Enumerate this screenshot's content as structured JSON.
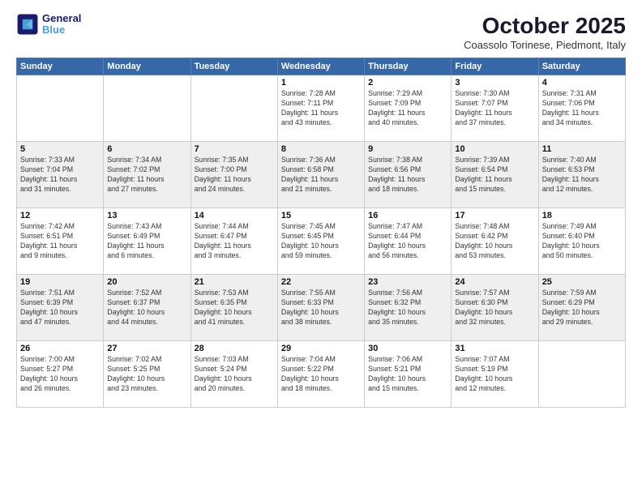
{
  "header": {
    "logo_line1": "General",
    "logo_line2": "Blue",
    "month": "October 2025",
    "location": "Coassolo Torinese, Piedmont, Italy"
  },
  "weekdays": [
    "Sunday",
    "Monday",
    "Tuesday",
    "Wednesday",
    "Thursday",
    "Friday",
    "Saturday"
  ],
  "weeks": [
    [
      {
        "date": "",
        "info": ""
      },
      {
        "date": "",
        "info": ""
      },
      {
        "date": "",
        "info": ""
      },
      {
        "date": "1",
        "info": "Sunrise: 7:28 AM\nSunset: 7:11 PM\nDaylight: 11 hours\nand 43 minutes."
      },
      {
        "date": "2",
        "info": "Sunrise: 7:29 AM\nSunset: 7:09 PM\nDaylight: 11 hours\nand 40 minutes."
      },
      {
        "date": "3",
        "info": "Sunrise: 7:30 AM\nSunset: 7:07 PM\nDaylight: 11 hours\nand 37 minutes."
      },
      {
        "date": "4",
        "info": "Sunrise: 7:31 AM\nSunset: 7:06 PM\nDaylight: 11 hours\nand 34 minutes."
      }
    ],
    [
      {
        "date": "5",
        "info": "Sunrise: 7:33 AM\nSunset: 7:04 PM\nDaylight: 11 hours\nand 31 minutes."
      },
      {
        "date": "6",
        "info": "Sunrise: 7:34 AM\nSunset: 7:02 PM\nDaylight: 11 hours\nand 27 minutes."
      },
      {
        "date": "7",
        "info": "Sunrise: 7:35 AM\nSunset: 7:00 PM\nDaylight: 11 hours\nand 24 minutes."
      },
      {
        "date": "8",
        "info": "Sunrise: 7:36 AM\nSunset: 6:58 PM\nDaylight: 11 hours\nand 21 minutes."
      },
      {
        "date": "9",
        "info": "Sunrise: 7:38 AM\nSunset: 6:56 PM\nDaylight: 11 hours\nand 18 minutes."
      },
      {
        "date": "10",
        "info": "Sunrise: 7:39 AM\nSunset: 6:54 PM\nDaylight: 11 hours\nand 15 minutes."
      },
      {
        "date": "11",
        "info": "Sunrise: 7:40 AM\nSunset: 6:53 PM\nDaylight: 11 hours\nand 12 minutes."
      }
    ],
    [
      {
        "date": "12",
        "info": "Sunrise: 7:42 AM\nSunset: 6:51 PM\nDaylight: 11 hours\nand 9 minutes."
      },
      {
        "date": "13",
        "info": "Sunrise: 7:43 AM\nSunset: 6:49 PM\nDaylight: 11 hours\nand 6 minutes."
      },
      {
        "date": "14",
        "info": "Sunrise: 7:44 AM\nSunset: 6:47 PM\nDaylight: 11 hours\nand 3 minutes."
      },
      {
        "date": "15",
        "info": "Sunrise: 7:45 AM\nSunset: 6:45 PM\nDaylight: 10 hours\nand 59 minutes."
      },
      {
        "date": "16",
        "info": "Sunrise: 7:47 AM\nSunset: 6:44 PM\nDaylight: 10 hours\nand 56 minutes."
      },
      {
        "date": "17",
        "info": "Sunrise: 7:48 AM\nSunset: 6:42 PM\nDaylight: 10 hours\nand 53 minutes."
      },
      {
        "date": "18",
        "info": "Sunrise: 7:49 AM\nSunset: 6:40 PM\nDaylight: 10 hours\nand 50 minutes."
      }
    ],
    [
      {
        "date": "19",
        "info": "Sunrise: 7:51 AM\nSunset: 6:39 PM\nDaylight: 10 hours\nand 47 minutes."
      },
      {
        "date": "20",
        "info": "Sunrise: 7:52 AM\nSunset: 6:37 PM\nDaylight: 10 hours\nand 44 minutes."
      },
      {
        "date": "21",
        "info": "Sunrise: 7:53 AM\nSunset: 6:35 PM\nDaylight: 10 hours\nand 41 minutes."
      },
      {
        "date": "22",
        "info": "Sunrise: 7:55 AM\nSunset: 6:33 PM\nDaylight: 10 hours\nand 38 minutes."
      },
      {
        "date": "23",
        "info": "Sunrise: 7:56 AM\nSunset: 6:32 PM\nDaylight: 10 hours\nand 35 minutes."
      },
      {
        "date": "24",
        "info": "Sunrise: 7:57 AM\nSunset: 6:30 PM\nDaylight: 10 hours\nand 32 minutes."
      },
      {
        "date": "25",
        "info": "Sunrise: 7:59 AM\nSunset: 6:29 PM\nDaylight: 10 hours\nand 29 minutes."
      }
    ],
    [
      {
        "date": "26",
        "info": "Sunrise: 7:00 AM\nSunset: 5:27 PM\nDaylight: 10 hours\nand 26 minutes."
      },
      {
        "date": "27",
        "info": "Sunrise: 7:02 AM\nSunset: 5:25 PM\nDaylight: 10 hours\nand 23 minutes."
      },
      {
        "date": "28",
        "info": "Sunrise: 7:03 AM\nSunset: 5:24 PM\nDaylight: 10 hours\nand 20 minutes."
      },
      {
        "date": "29",
        "info": "Sunrise: 7:04 AM\nSunset: 5:22 PM\nDaylight: 10 hours\nand 18 minutes."
      },
      {
        "date": "30",
        "info": "Sunrise: 7:06 AM\nSunset: 5:21 PM\nDaylight: 10 hours\nand 15 minutes."
      },
      {
        "date": "31",
        "info": "Sunrise: 7:07 AM\nSunset: 5:19 PM\nDaylight: 10 hours\nand 12 minutes."
      },
      {
        "date": "",
        "info": ""
      }
    ]
  ]
}
